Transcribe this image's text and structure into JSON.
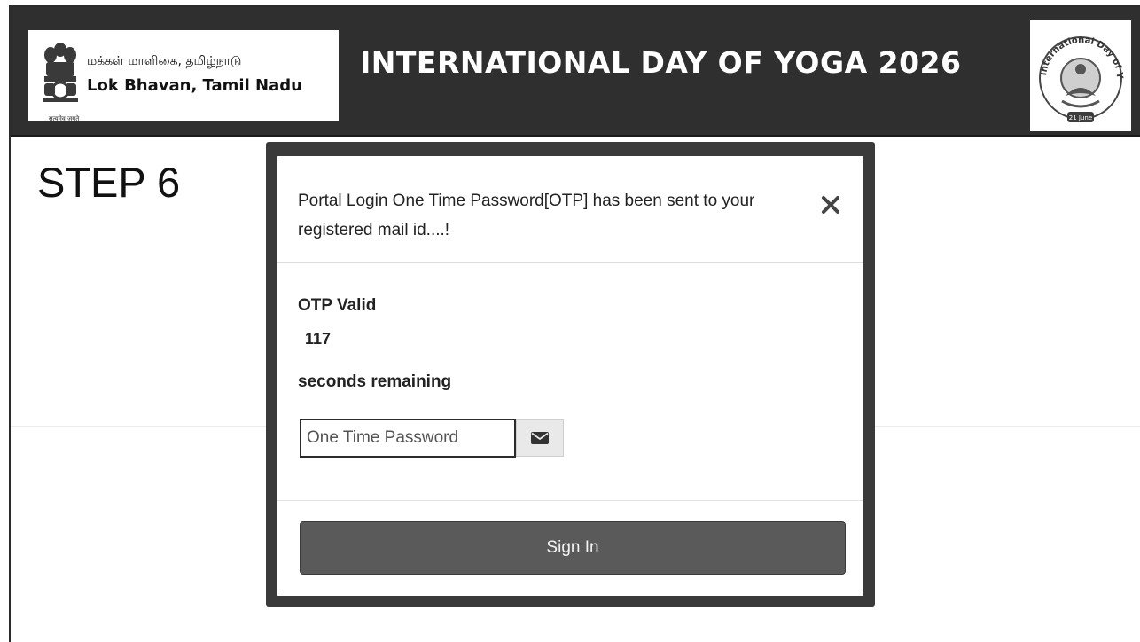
{
  "header": {
    "logo_tamil": "மக்கள் மாளிகை, தமிழ்நாடு",
    "logo_english": "Lok Bhavan, Tamil Nadu",
    "emblem_caption": "सत्यमेव जयते",
    "title": "INTERNATIONAL DAY OF YOGA 2026",
    "yoga_logo_text_top": "International Day of Yoga",
    "yoga_logo_date": "21 June"
  },
  "step": {
    "label": "STEP 6"
  },
  "modal": {
    "message": "Portal Login One Time Password[OTP] has been sent to your registered mail id....!",
    "otp_valid_label": "OTP Valid",
    "otp_seconds": "117",
    "seconds_remaining_label": "seconds remaining",
    "otp_placeholder": "One Time Password",
    "otp_value": "",
    "signin_label": "Sign In"
  },
  "icons": {
    "close": "close-icon",
    "mail": "envelope-icon",
    "emblem": "national-emblem-icon",
    "yoga": "yoga-day-logo-icon"
  }
}
